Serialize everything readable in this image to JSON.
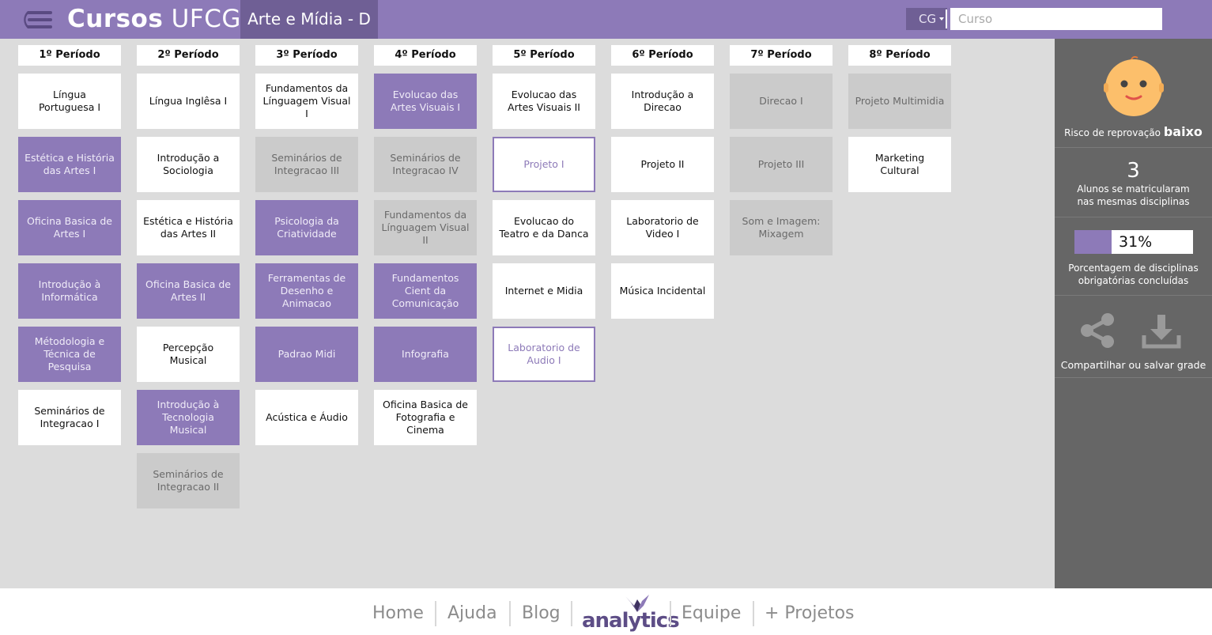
{
  "header": {
    "brand_bold": "Cursos",
    "brand_light": "UFCG",
    "course": "Arte e Mídia - D",
    "campus": "CG",
    "search_placeholder": "Curso",
    "colors": {
      "bar": "#8d7ab8",
      "accent_dark": "#6f5f95"
    }
  },
  "periods": [
    {
      "title": "1º Período",
      "courses": [
        {
          "name": "Língua Portuguesa I",
          "status": "available"
        },
        {
          "name": "Estética e História das Artes I",
          "status": "done"
        },
        {
          "name": "Oficina Basica de Artes I",
          "status": "done"
        },
        {
          "name": "Introdução à Informática",
          "status": "done"
        },
        {
          "name": "Métodologia e Técnica de Pesquisa",
          "status": "done"
        },
        {
          "name": "Seminários de Integracao I",
          "status": "available"
        }
      ]
    },
    {
      "title": "2º Período",
      "courses": [
        {
          "name": "Língua Inglêsa I",
          "status": "available"
        },
        {
          "name": "Introdução a Sociologia",
          "status": "available"
        },
        {
          "name": "Estética e História das Artes II",
          "status": "available"
        },
        {
          "name": "Oficina Basica de Artes II",
          "status": "done"
        },
        {
          "name": "Percepção Musical",
          "status": "available"
        },
        {
          "name": "Introdução à Tecnologia Musical",
          "status": "done"
        },
        {
          "name": "Seminários de Integracao II",
          "status": "pending"
        }
      ]
    },
    {
      "title": "3º Período",
      "courses": [
        {
          "name": "Fundamentos da Línguagem Visual I",
          "status": "available"
        },
        {
          "name": "Seminários de Integracao III",
          "status": "pending"
        },
        {
          "name": "Psicologia da Criatividade",
          "status": "done"
        },
        {
          "name": "Ferramentas de Desenho e Animacao",
          "status": "done"
        },
        {
          "name": "Padrao Midi",
          "status": "done"
        },
        {
          "name": "Acústica e Áudio",
          "status": "available"
        }
      ]
    },
    {
      "title": "4º Período",
      "courses": [
        {
          "name": "Evolucao das Artes Visuais I",
          "status": "done"
        },
        {
          "name": "Seminários de Integracao IV",
          "status": "pending"
        },
        {
          "name": "Fundamentos da Línguagem Visual II",
          "status": "pending"
        },
        {
          "name": "Fundamentos Cient da Comunicação",
          "status": "done"
        },
        {
          "name": "Infografia",
          "status": "done"
        },
        {
          "name": "Oficina Basica de Fotografia e Cinema",
          "status": "available"
        }
      ]
    },
    {
      "title": "5º Período",
      "courses": [
        {
          "name": "Evolucao das Artes Visuais II",
          "status": "available"
        },
        {
          "name": "Projeto I",
          "status": "selected"
        },
        {
          "name": "Evolucao do Teatro e da Danca",
          "status": "available"
        },
        {
          "name": "Internet e Midia",
          "status": "available"
        },
        {
          "name": "Laboratorio de Audio I",
          "status": "selected"
        }
      ]
    },
    {
      "title": "6º Período",
      "courses": [
        {
          "name": "Introdução a Direcao",
          "status": "available"
        },
        {
          "name": "Projeto II",
          "status": "available"
        },
        {
          "name": "Laboratorio de Video I",
          "status": "available"
        },
        {
          "name": "Música Incidental",
          "status": "available"
        }
      ]
    },
    {
      "title": "7º Período",
      "courses": [
        {
          "name": "Direcao I",
          "status": "pending"
        },
        {
          "name": "Projeto III",
          "status": "pending"
        },
        {
          "name": "Som e Imagem: Mixagem",
          "status": "pending"
        }
      ]
    },
    {
      "title": "8º Período",
      "courses": [
        {
          "name": "Projeto Multimidia",
          "status": "pending"
        },
        {
          "name": "Marketing Cultural",
          "status": "available"
        }
      ]
    }
  ],
  "sidebar": {
    "risk_label": "Risco de reprovação",
    "risk_value": "baixo",
    "students_count": "3",
    "students_label": "Alunos se matricularam nas mesmas disciplinas",
    "progress_text": "31%",
    "progress_fraction": 0.31,
    "progress_label": "Porcentagem de disciplinas obrigatórias concluídas",
    "share_label": "Compartilhar ou salvar grade",
    "risk_icon": "baby-face-icon",
    "share_icon": "share-icon",
    "download_icon": "download-icon"
  },
  "footer": {
    "home": "Home",
    "help": "Ajuda",
    "blog": "Blog",
    "logo_text": "analytics",
    "team": "Equipe",
    "projects": "+ Projetos"
  }
}
